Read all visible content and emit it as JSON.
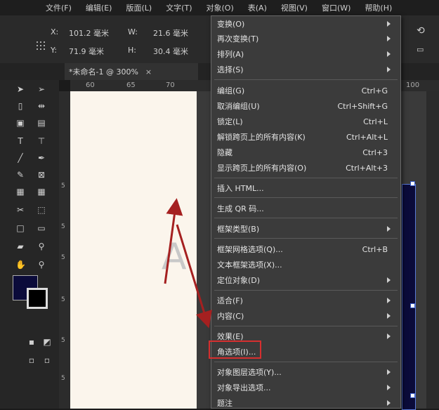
{
  "menubar": {
    "items": [
      "文件(F)",
      "编辑(E)",
      "版面(L)",
      "文字(T)",
      "对象(O)",
      "表(A)",
      "视图(V)",
      "窗口(W)",
      "帮助(H)"
    ]
  },
  "control": {
    "x_label": "X:",
    "x_value": "101.2 毫米",
    "y_label": "Y:",
    "y_value": "71.9 毫米",
    "w_label": "W:",
    "w_value": "21.6 毫米",
    "h_label": "H:",
    "h_value": "30.4 毫米"
  },
  "tab": {
    "title": "*未命名-1 @ 300%",
    "close": "×"
  },
  "ruler": {
    "h_ticks": [
      "60",
      "65",
      "70",
      "100"
    ],
    "v_ticks": [
      "5",
      "5",
      "5",
      "5",
      "5",
      "5"
    ]
  },
  "canvas": {
    "glyph": "A"
  },
  "colors": {
    "menu_bg": "#3b3b3b",
    "highlight_box": "#d62f2f",
    "arrow": "#a52020",
    "page": "#fbf5ec",
    "frame_fill": "#0b0b3a"
  },
  "menu": {
    "items": [
      {
        "label": "变换(O)",
        "shortcut": "",
        "submenu": true
      },
      {
        "label": "再次变换(T)",
        "shortcut": "",
        "submenu": true
      },
      {
        "label": "排列(A)",
        "shortcut": "",
        "submenu": true
      },
      {
        "label": "选择(S)",
        "shortcut": "",
        "submenu": true
      },
      {
        "label": "编组(G)",
        "shortcut": "Ctrl+G",
        "submenu": false
      },
      {
        "label": "取消编组(U)",
        "shortcut": "Ctrl+Shift+G",
        "submenu": false
      },
      {
        "label": "锁定(L)",
        "shortcut": "Ctrl+L",
        "submenu": false
      },
      {
        "label": "解锁跨页上的所有内容(K)",
        "shortcut": "Ctrl+Alt+L",
        "submenu": false
      },
      {
        "label": "隐藏",
        "shortcut": "Ctrl+3",
        "submenu": false
      },
      {
        "label": "显示跨页上的所有内容(O)",
        "shortcut": "Ctrl+Alt+3",
        "submenu": false
      },
      {
        "label": "插入 HTML...",
        "shortcut": "",
        "submenu": false
      },
      {
        "label": "生成 QR 码...",
        "shortcut": "",
        "submenu": false
      },
      {
        "label": "框架类型(B)",
        "shortcut": "",
        "submenu": true
      },
      {
        "label": "框架网格选项(Q)...",
        "shortcut": "Ctrl+B",
        "submenu": false
      },
      {
        "label": "文本框架选项(X)...",
        "shortcut": "",
        "submenu": false
      },
      {
        "label": "定位对象(D)",
        "shortcut": "",
        "submenu": true
      },
      {
        "label": "适合(F)",
        "shortcut": "",
        "submenu": true
      },
      {
        "label": "内容(C)",
        "shortcut": "",
        "submenu": true
      },
      {
        "label": "效果(E)",
        "shortcut": "",
        "submenu": true
      },
      {
        "label": "角选项(I)...",
        "shortcut": "",
        "submenu": false
      },
      {
        "label": "对象图层选项(Y)...",
        "shortcut": "",
        "submenu": true
      },
      {
        "label": "对象导出选项...",
        "shortcut": "",
        "submenu": true
      },
      {
        "label": "题注",
        "shortcut": "",
        "submenu": true
      }
    ]
  }
}
